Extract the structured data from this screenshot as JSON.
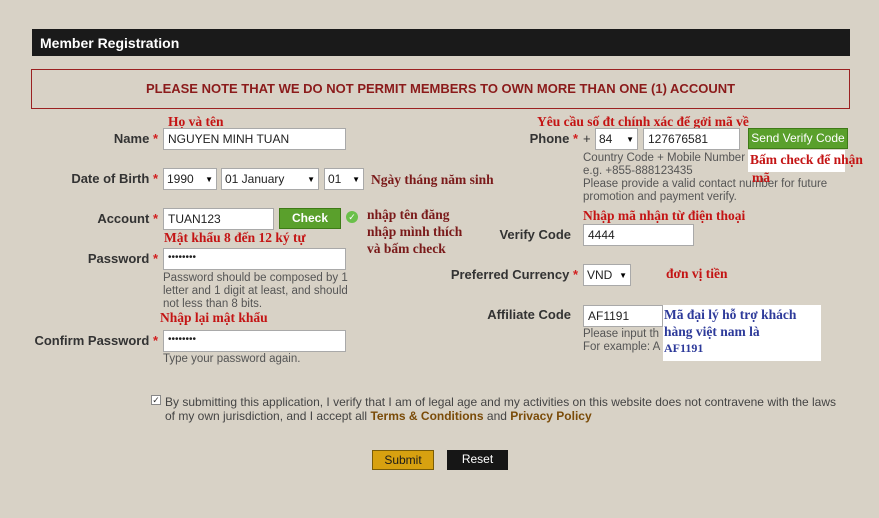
{
  "header": {
    "title": "Member Registration"
  },
  "notice": {
    "text": "PLEASE NOTE THAT WE DO NOT PERMIT MEMBERS TO OWN MORE THAN ONE (1) ACCOUNT"
  },
  "form": {
    "required_mark": "*",
    "name": {
      "label": "Name",
      "value": "NGUYEN MINH TUAN"
    },
    "dob": {
      "label": "Date of Birth",
      "year": "1990",
      "month": "01 January",
      "day": "01"
    },
    "account": {
      "label": "Account",
      "value": "TUAN123",
      "check_label": "Check"
    },
    "password": {
      "label": "Password",
      "value": "••••••••",
      "hint_lines": [
        "Password should be composed by 1",
        "letter and 1 digit at least, and should",
        "not less than 8 bits."
      ]
    },
    "confirm_password": {
      "label": "Confirm Password",
      "value": "••••••••",
      "hint": "Type your password again."
    },
    "phone": {
      "label": "Phone",
      "plus": "+",
      "country_code": "84",
      "number": "127676581",
      "send_label": "Send Verify Code",
      "hint_lines": [
        "Country Code + Mobile Number",
        "e.g. +855-888123435",
        "Please provide a valid contact number for future",
        "promotion and payment verify."
      ]
    },
    "verify_code": {
      "label": "Verify Code",
      "value": "4444"
    },
    "currency": {
      "label": "Preferred Currency",
      "value": "VND"
    },
    "affiliate": {
      "label": "Affiliate Code",
      "value": "AF1191",
      "hint_lines": [
        "Please input th",
        "For example: A"
      ]
    },
    "agreement": {
      "text_line1": "By submitting this application, I verify that I am of legal age and my activities on this website does not contravene with the laws",
      "text_line2_prefix": "of my own jurisdiction, and I accept all ",
      "terms": "Terms & Conditions",
      "and": " and ",
      "privacy": "Privacy Policy"
    },
    "submit_label": "Submit",
    "reset_label": "Reset"
  },
  "annotations": {
    "ho_va_ten": "Họ và tên",
    "ngay_thang": "Ngày tháng năm sinh",
    "nhap_ten_1": "nhập tên đăng",
    "nhap_ten_2": "nhập mình thích",
    "nhap_ten_3": "và bấm check",
    "mat_khau": "Mật khẩu 8 đến 12 ký tự",
    "nhap_lai": "Nhập lại mật khẩu",
    "yeu_cau_sdt": "Yêu cầu số đt chính xác để gởi mã về",
    "bam_check_1": "Bấm check để nhận",
    "bam_check_2": "mã",
    "nhap_ma": "Nhập mã nhận từ điện thoại",
    "don_vi_tien": "đơn vị tiền",
    "ma_dai_ly_1": "Mã đại lý hỗ trợ khách",
    "ma_dai_ly_2": "hàng việt nam là",
    "ma_dai_ly_3": "AF1191"
  }
}
